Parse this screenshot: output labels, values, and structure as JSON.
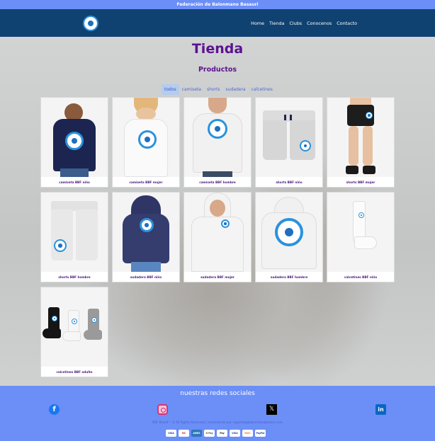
{
  "topbar": {
    "text": "Federación de Balonmano Basauri"
  },
  "nav": {
    "logo_icon": "bbf-logo-icon",
    "links": [
      "Home",
      "Tienda",
      "Clubs",
      "Conocenos",
      "Contacto"
    ]
  },
  "main": {
    "title": "Tienda",
    "subtitle": "Productos",
    "filters": [
      "todos",
      "camiseta",
      "shorts",
      "sudadera",
      "calcetines"
    ],
    "active_filter": "todos",
    "products": [
      {
        "name": "camiseta BBF niño"
      },
      {
        "name": "camiseta BBF mujer"
      },
      {
        "name": "camiseta BBF hombre"
      },
      {
        "name": "shorts BBF niño"
      },
      {
        "name": "shorts BBF mujer"
      },
      {
        "name": "shorts BBF hombre"
      },
      {
        "name": "sudadera BBF niño"
      },
      {
        "name": "sudadera BBF mujer"
      },
      {
        "name": "sudadera BBF hombre"
      },
      {
        "name": "calcetines BBF niño"
      },
      {
        "name": "calcetines BBF adulto"
      }
    ]
  },
  "footer": {
    "title": "nuestras redes sociales",
    "social_icons": [
      "facebook-icon",
      "instagram-icon",
      "x-icon",
      "linkedin-icon"
    ],
    "credit": "BBF Brand™ © All Rights Reserved | contactanos por: soporte@balonmanobasauri.com",
    "payments": [
      "VISA",
      "MC",
      "AMEX",
      "G Pay",
      "Pay",
      "VISA",
      "DISC",
      "PayPal"
    ]
  },
  "colors": {
    "brand_blue": "#6b8ef7",
    "nav_dark": "#0f4270",
    "title_purple": "#5c1291",
    "badge_blue": "#2a92dc"
  }
}
